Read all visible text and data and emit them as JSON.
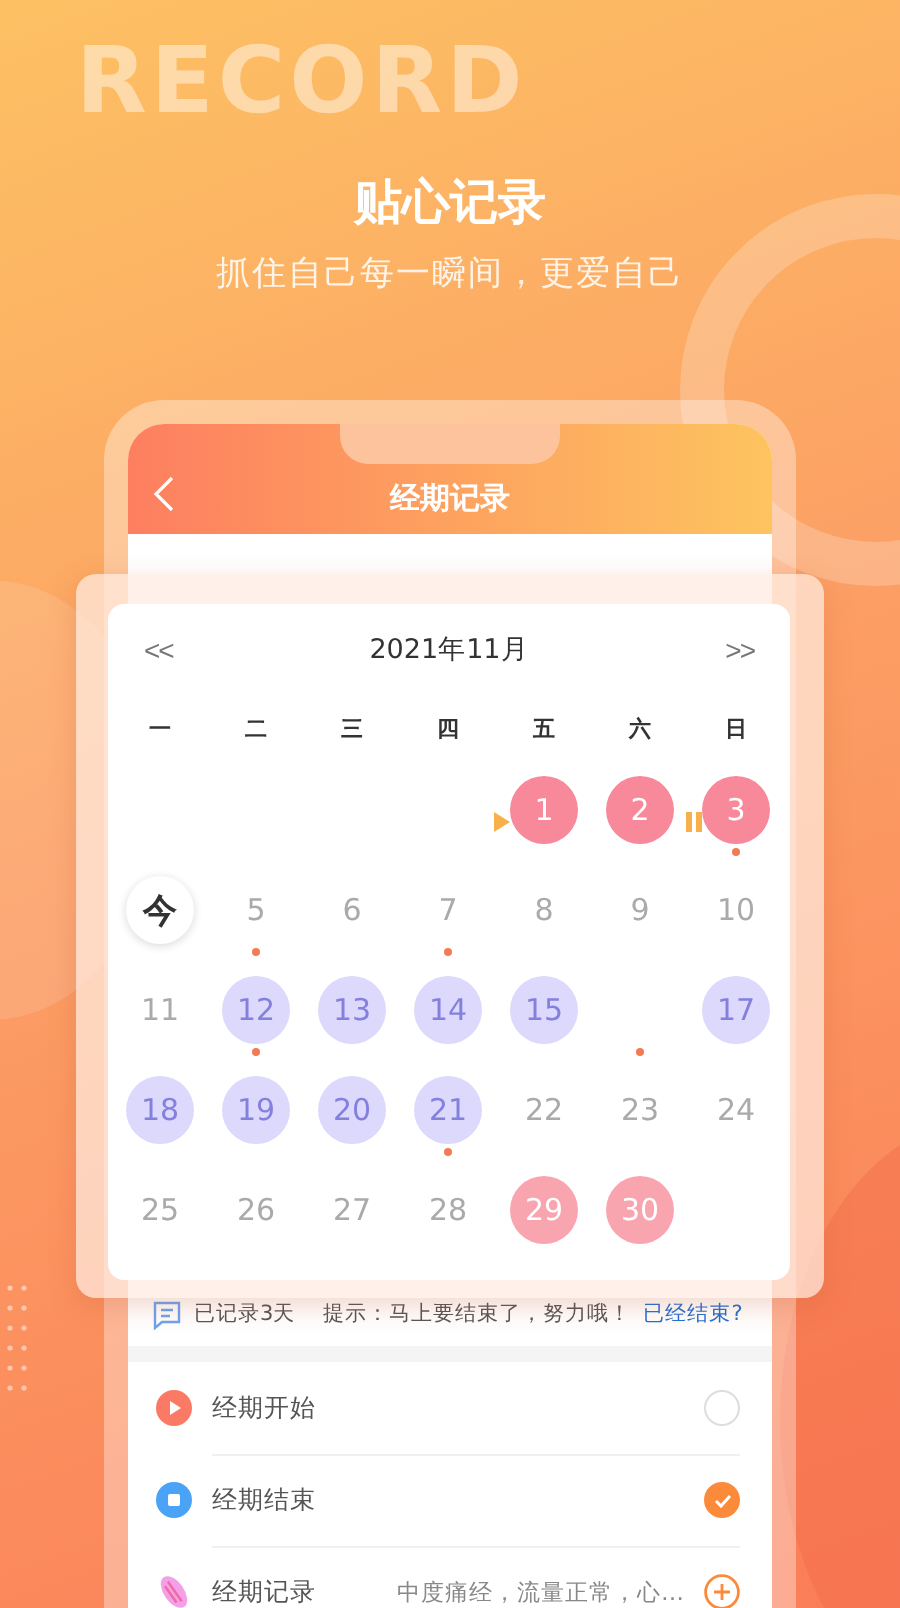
{
  "banner": {
    "background_word": "RECORD",
    "title": "贴心记录",
    "subtitle": "抓住自己每一瞬间，更爱自己"
  },
  "phone": {
    "header": {
      "title": "经期记录"
    }
  },
  "calendar": {
    "prev": "<<",
    "month": "2021年11月",
    "next": ">>",
    "weekdays": [
      "一",
      "二",
      "三",
      "四",
      "五",
      "六",
      "日"
    ],
    "weeks": [
      [
        {
          "kind": "blank",
          "dot": false
        },
        {
          "kind": "blank",
          "dot": false
        },
        {
          "kind": "blank",
          "dot": false
        },
        {
          "kind": "blank",
          "dot": false
        },
        {
          "kind": "period",
          "label": "1",
          "dot": false,
          "marker": {
            "kind": "start"
          }
        },
        {
          "kind": "period",
          "label": "2",
          "dot": false
        },
        {
          "kind": "period",
          "label": "3",
          "dot": true,
          "marker": {
            "kind": "pause"
          }
        }
      ],
      [
        {
          "kind": "today",
          "label": "今",
          "dot": false
        },
        {
          "kind": "plain",
          "label": "5",
          "dot": true
        },
        {
          "kind": "plain",
          "label": "6",
          "dot": false
        },
        {
          "kind": "plain",
          "label": "7",
          "dot": true
        },
        {
          "kind": "plain",
          "label": "8",
          "dot": false
        },
        {
          "kind": "plain",
          "label": "9",
          "dot": false
        },
        {
          "kind": "plain",
          "label": "10",
          "dot": false
        }
      ],
      [
        {
          "kind": "plain",
          "label": "11",
          "dot": false
        },
        {
          "kind": "fertile",
          "label": "12",
          "dot": true
        },
        {
          "kind": "fertile",
          "label": "13",
          "dot": false
        },
        {
          "kind": "fertile",
          "label": "14",
          "dot": false
        },
        {
          "kind": "fertile",
          "label": "15",
          "dot": false
        },
        {
          "kind": "blank",
          "dot": true
        },
        {
          "kind": "fertile",
          "label": "17",
          "dot": false
        }
      ],
      [
        {
          "kind": "fertile",
          "label": "18",
          "dot": false
        },
        {
          "kind": "fertile",
          "label": "19",
          "dot": false
        },
        {
          "kind": "fertile",
          "label": "20",
          "dot": false
        },
        {
          "kind": "fertile",
          "label": "21",
          "dot": true
        },
        {
          "kind": "plain",
          "label": "22",
          "dot": false
        },
        {
          "kind": "plain",
          "label": "23",
          "dot": false
        },
        {
          "kind": "plain",
          "label": "24",
          "dot": false
        }
      ],
      [
        {
          "kind": "plain",
          "label": "25",
          "dot": false
        },
        {
          "kind": "plain",
          "label": "26",
          "dot": false
        },
        {
          "kind": "plain",
          "label": "27",
          "dot": false
        },
        {
          "kind": "plain",
          "label": "28",
          "dot": false
        },
        {
          "kind": "forecast",
          "label": "29",
          "dot": false
        },
        {
          "kind": "forecast",
          "label": "30",
          "dot": false
        },
        {
          "kind": "blank",
          "dot": false
        }
      ]
    ]
  },
  "status": {
    "recorded": "已记录3天",
    "tip": "提示：马上要结束了，努力哦！",
    "link": "已经结束?"
  },
  "items": [
    {
      "kind": "start",
      "label": "经期开始",
      "control": {
        "kind": "check",
        "checked": false
      }
    },
    {
      "kind": "end",
      "label": "经期结束",
      "control": {
        "kind": "check",
        "checked": true
      }
    },
    {
      "kind": "record",
      "label": "经期记录",
      "value": "中度痛经，流量正常，心…",
      "control": {
        "kind": "add"
      }
    }
  ]
}
